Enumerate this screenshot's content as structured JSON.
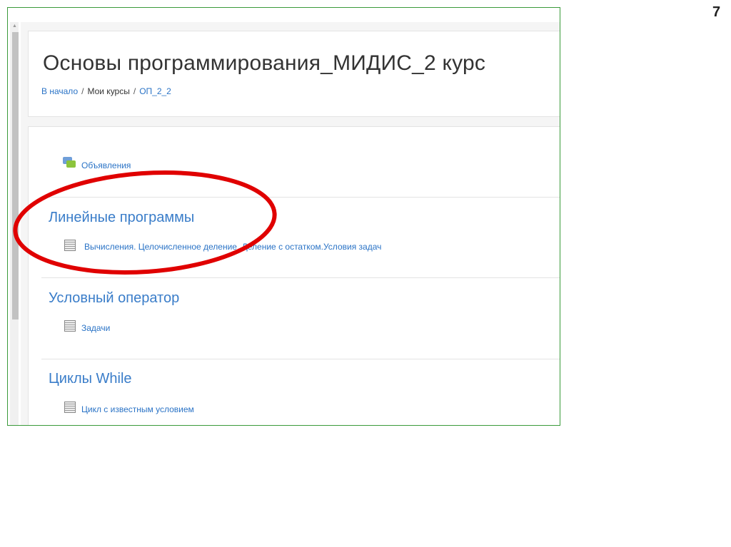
{
  "slide_number": "7",
  "course_title": "Основы программирования_МИДИС_2 курс",
  "breadcrumb": [
    {
      "label": "В начало"
    },
    {
      "label": "Мои курсы"
    },
    {
      "label": "ОП_2_2"
    }
  ],
  "breadcrumb_sep": "/",
  "announcements": "Объявления",
  "sections": [
    {
      "title": "Линейные программы",
      "item": "Вычисления. Целочисленное деление. Деление с остатком.Условия задач"
    },
    {
      "title": "Условный оператор",
      "item": "Задачи"
    },
    {
      "title": "Циклы While",
      "item": "Цикл с известным условием"
    }
  ],
  "colors": {
    "link": "#2a73c6",
    "highlight": "#e00000",
    "frame": "#3a9a3a"
  }
}
